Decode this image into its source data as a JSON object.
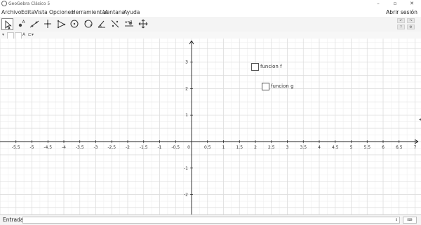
{
  "window": {
    "title": "GeoGebra Clásico 5"
  },
  "menu": {
    "items": [
      "Archivo",
      "Edita",
      "Vista",
      "Opciones",
      "Herramientas",
      "Ventana",
      "Ayuda"
    ],
    "signin_label": "Abrir sesión"
  },
  "toolbar": {
    "tools": [
      "move-tool",
      "point-tool",
      "line-tool",
      "perpendicular-tool",
      "polygon-tool",
      "circle-tool",
      "conic-tool",
      "angle-tool",
      "reflect-tool",
      "slider-tool",
      "move-view-tool"
    ],
    "active_tool": "move-tool"
  },
  "stylebar": {
    "label_mode": "A",
    "color": "#444444"
  },
  "graphics": {
    "x_ticks": [
      "-5.5",
      "-5",
      "-4.5",
      "-4",
      "-3.5",
      "-3",
      "-2.5",
      "-2",
      "-1.5",
      "-1",
      "-0.5",
      "0",
      "0.5",
      "1",
      "1.5",
      "2",
      "2.5",
      "3",
      "3.5",
      "4",
      "4.5",
      "5",
      "5.5",
      "6",
      "6.5",
      "7"
    ],
    "y_ticks": [
      "3",
      "2",
      "1",
      "-1",
      "-2"
    ],
    "checkboxes": [
      {
        "label": "funcion f",
        "checked": false
      },
      {
        "label": "funcion g",
        "checked": false
      }
    ],
    "grid": true
  },
  "input": {
    "label": "Entrada:",
    "value": ""
  }
}
